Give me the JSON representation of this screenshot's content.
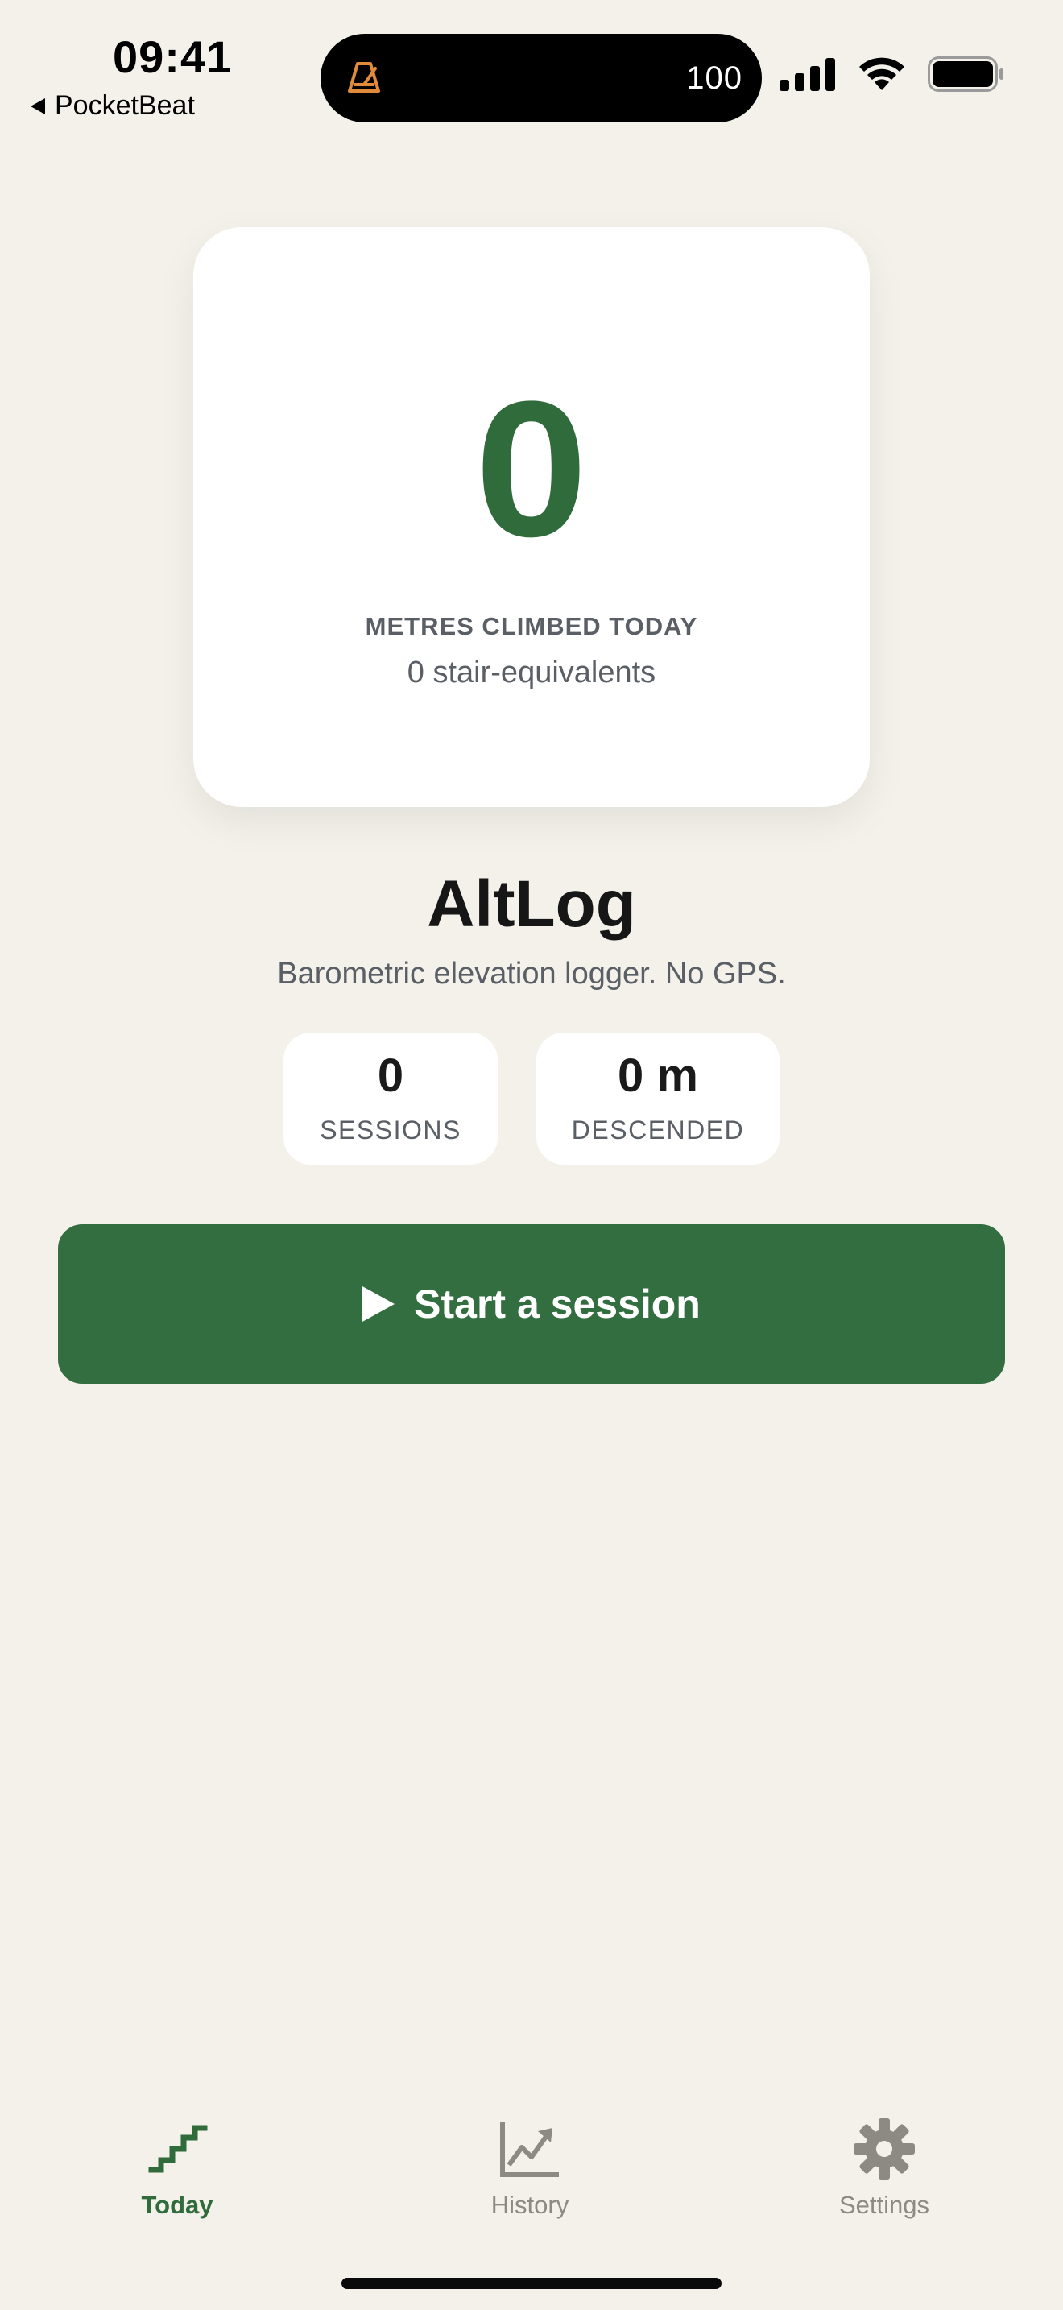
{
  "status_bar": {
    "time": "09:41",
    "back_app": "PocketBeat",
    "island_value": "100"
  },
  "hero": {
    "value": "0",
    "label": "METRES CLIMBED TODAY",
    "sub": "0 stair-equivalents"
  },
  "app": {
    "title": "AltLog",
    "subtitle": "Barometric elevation logger. No GPS."
  },
  "stats": {
    "sessions_value": "0",
    "sessions_label": "SESSIONS",
    "descended_value": "0 m",
    "descended_label": "DESCENDED"
  },
  "actions": {
    "start_label": "Start a session"
  },
  "tabs": [
    {
      "label": "Today",
      "icon": "stairs-icon",
      "active": true
    },
    {
      "label": "History",
      "icon": "chart-trend-icon",
      "active": false
    },
    {
      "label": "Settings",
      "icon": "gear-icon",
      "active": false
    }
  ],
  "colors": {
    "accent": "#2f6b3b",
    "button": "#336e40",
    "background": "#f3f1ea",
    "island_icon": "#e08a3c"
  }
}
